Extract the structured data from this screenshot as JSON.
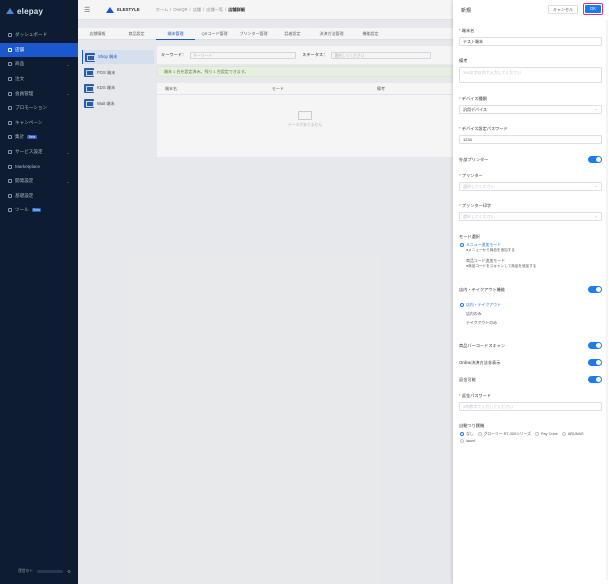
{
  "app": {
    "logo": "elepay"
  },
  "sidebar": {
    "items": [
      {
        "label": "ダッシュボード",
        "icon": "dashboard-icon",
        "active": false,
        "chevron": false
      },
      {
        "label": "店舗",
        "icon": "store-icon",
        "active": true,
        "chevron": false
      },
      {
        "label": "商品",
        "icon": "product-icon",
        "active": false,
        "chevron": true
      },
      {
        "label": "注文",
        "icon": "order-icon",
        "active": false,
        "chevron": false
      },
      {
        "label": "会員管理",
        "icon": "member-icon",
        "active": false,
        "chevron": true
      },
      {
        "label": "プロモーション",
        "icon": "promotion-icon",
        "active": false,
        "chevron": false
      },
      {
        "label": "キャンペーン",
        "icon": "campaign-icon",
        "active": false,
        "chevron": false
      },
      {
        "label": "集計",
        "icon": "chart-icon",
        "active": false,
        "chevron": false,
        "badge": "Beta"
      },
      {
        "label": "サービス設定",
        "icon": "service-icon",
        "active": false,
        "chevron": true
      },
      {
        "label": "Marketplace",
        "icon": "marketplace-icon",
        "active": false,
        "chevron": false
      },
      {
        "label": "開発設定",
        "icon": "dev-icon",
        "active": false,
        "chevron": true
      },
      {
        "label": "基礎設定",
        "icon": "settings-icon",
        "active": false,
        "chevron": false
      },
      {
        "label": "ツール",
        "icon": "tool-icon",
        "active": false,
        "chevron": false,
        "badge": "Beta"
      }
    ],
    "footer_label": "運営のト"
  },
  "topbar": {
    "brand": "ELESTYLE",
    "breadcrumbs": [
      "ホーム",
      "/",
      "OneQR",
      "/",
      "店舗",
      "/",
      "店舗一覧",
      "/"
    ],
    "current": "店舗詳細"
  },
  "subtabs": [
    "店舗情報",
    "商品設定",
    "端末管理",
    "QRコード管理",
    "プリンター管理",
    "話者設定",
    "決済方法管理",
    "機能設定"
  ],
  "devices": [
    {
      "label": "Shop 端末",
      "active": true
    },
    {
      "label": "POS 端末",
      "active": false
    },
    {
      "label": "KDS 端末",
      "active": false
    },
    {
      "label": "Wait 端末",
      "active": false
    }
  ],
  "filters": {
    "keyword_label": "キーワード：",
    "keyword_placeholder": "キーワード",
    "status_label": "ステータス：",
    "status_placeholder": "選択してください"
  },
  "notice": "端末 1 台を設定済み。残り 1 台設定できます。",
  "table": {
    "headers": [
      "端末名",
      "モード",
      "備考"
    ],
    "empty": "データがありません"
  },
  "drawer": {
    "title": "新規",
    "cancel": "キャンセル",
    "ok": "OK",
    "name_label": "端末名",
    "name_value": "テスト端末",
    "memo_label": "備考",
    "memo_placeholder": "300文字以内で入力してください",
    "device_type_label": "デバイス種類",
    "device_type_value": "汎用デバイス",
    "password_label": "デバイス設定パスワード",
    "password_value": "1234",
    "external_printer_label": "外部プリンター",
    "printer_label": "プリンター",
    "printer_placeholder": "選択してください",
    "printer_print_label": "プリンター印字",
    "printer_print_placeholder": "選択してください",
    "mode_label": "モード選択",
    "mode_options": [
      {
        "label": "メニュー追加モード",
        "sub": "●メニューから商品を追加する",
        "selected": true
      },
      {
        "label": "商品コード追加モード",
        "sub": "●商品コードをスキャンして商品を追加する",
        "selected": false
      }
    ],
    "eat_label": "店内・テイクアウト機能",
    "eat_options": [
      {
        "label": "店内・テイクアウト",
        "selected": true
      },
      {
        "label": "店内のみ",
        "selected": false
      },
      {
        "label": "テイクアウトのみ",
        "selected": false
      }
    ],
    "barcode_label": "商品バーコードスキャン",
    "online_label": "Online決済方法非表示",
    "refund_label": "返金可能",
    "refund_password_label": "返金パスワード",
    "refund_password_placeholder": "4桁数字で入力してください",
    "auto_change_label": "自動つり銭機",
    "auto_change_options": [
      {
        "label": "なし",
        "selected": true
      },
      {
        "label": "グローリー RT-300シリーズ",
        "selected": false
      },
      {
        "label": "Pay Cube",
        "selected": false
      },
      {
        "label": "ARUNAS",
        "selected": false
      },
      {
        "label": "laurel",
        "selected": false
      }
    ]
  }
}
